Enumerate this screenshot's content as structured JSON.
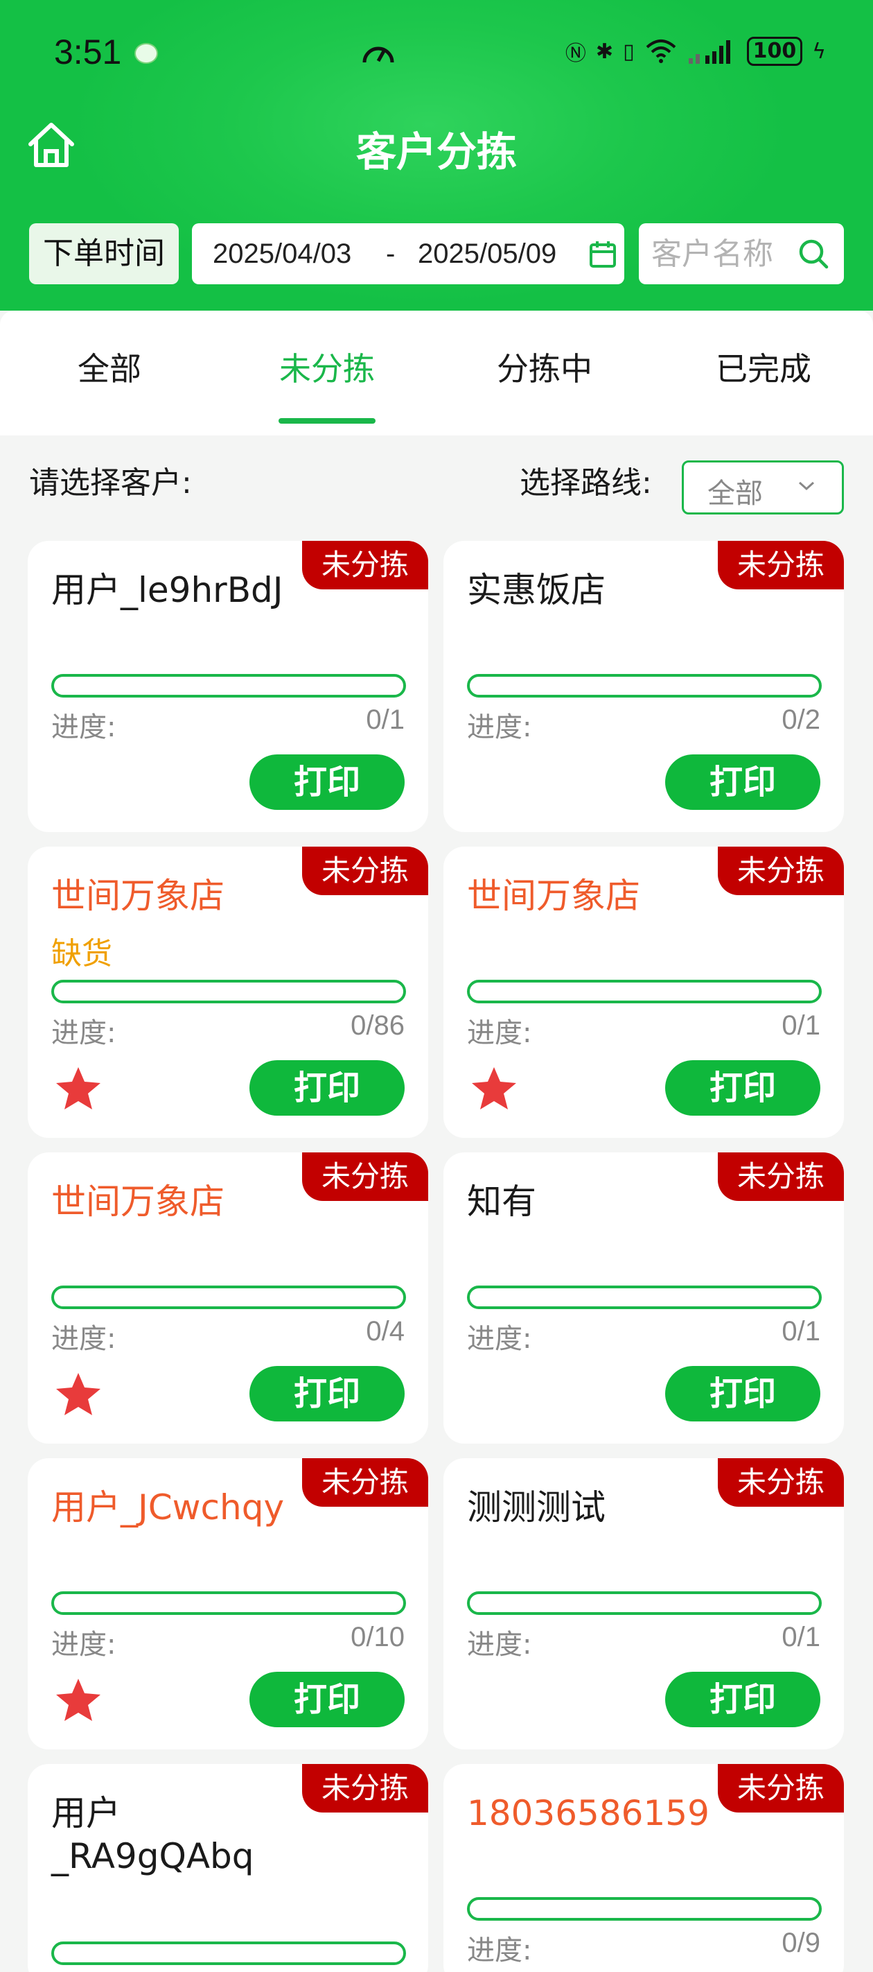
{
  "status": {
    "time": "3:51",
    "battery": "100"
  },
  "header": {
    "title": "客户分拣",
    "time_label": "下单时间",
    "date_start": "2025/04/03",
    "date_sep": "-",
    "date_end": "2025/05/09",
    "search_placeholder": "客户名称"
  },
  "tabs": [
    {
      "label": "全部"
    },
    {
      "label": "未分拣"
    },
    {
      "label": "分拣中"
    },
    {
      "label": "已完成"
    }
  ],
  "selector": {
    "customer_label": "请选择客户:",
    "route_label": "选择路线:",
    "route_value": "全部"
  },
  "cards": [
    {
      "name": "用户_le9hrBdJ",
      "badge": "未分拣",
      "progress_label": "进度:",
      "progress": "0/1",
      "print": "打印"
    },
    {
      "name": "实惠饭店",
      "badge": "未分拣",
      "progress_label": "进度:",
      "progress": "0/2",
      "print": "打印"
    },
    {
      "name": "世间万象店",
      "badge": "未分拣",
      "note": "缺货",
      "progress_label": "进度:",
      "progress": "0/86",
      "print": "打印"
    },
    {
      "name": "世间万象店",
      "badge": "未分拣",
      "progress_label": "进度:",
      "progress": "0/1",
      "print": "打印"
    },
    {
      "name": "世间万象店",
      "badge": "未分拣",
      "progress_label": "进度:",
      "progress": "0/4",
      "print": "打印"
    },
    {
      "name": "知有",
      "badge": "未分拣",
      "progress_label": "进度:",
      "progress": "0/1",
      "print": "打印"
    },
    {
      "name": "用户_JCwchqy",
      "badge": "未分拣",
      "progress_label": "进度:",
      "progress": "0/10",
      "print": "打印"
    },
    {
      "name": "测测测试",
      "badge": "未分拣",
      "progress_label": "进度:",
      "progress": "0/1",
      "print": "打印"
    },
    {
      "name": "用户_RA9gQAbq",
      "badge": "未分拣"
    },
    {
      "name": "18036586159",
      "badge": "未分拣",
      "progress_label": "进度:",
      "progress": "0/9"
    }
  ],
  "colors": {
    "brand_green": "#1ab74a",
    "badge_red": "#c20000",
    "name_orange": "#ef5b2b",
    "warning_amber": "#f0a000"
  }
}
